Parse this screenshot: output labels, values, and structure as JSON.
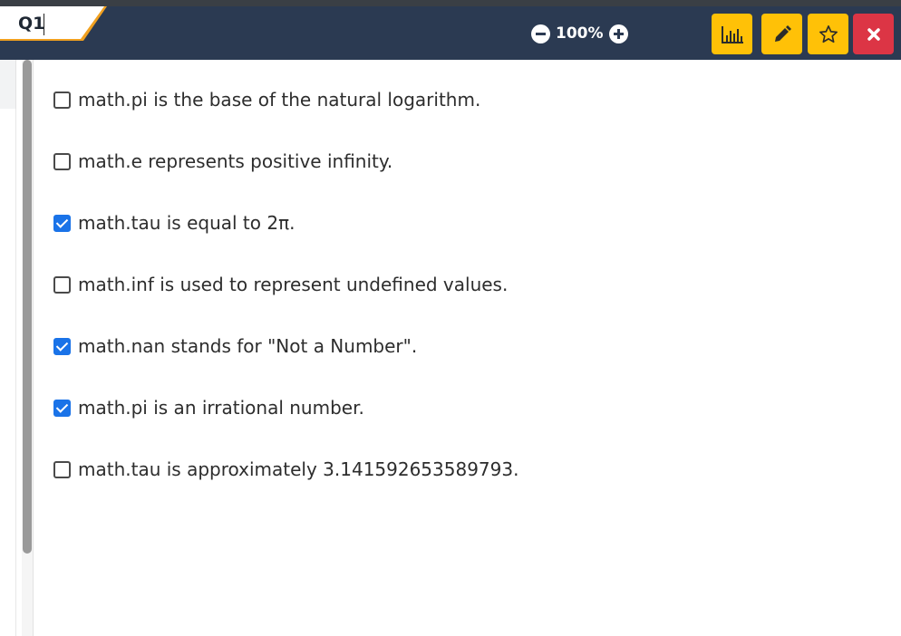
{
  "header": {
    "question_label": "Q1",
    "zoom_level": "100%",
    "accent_color": "#ffc107",
    "close_color": "#dc3545",
    "bar_color": "#2b3a52"
  },
  "toolbar": {
    "stats_icon": "bar-chart-icon",
    "edit_icon": "pencil-icon",
    "favorite_icon": "star-outline-icon",
    "close_icon": "close-icon"
  },
  "options": [
    {
      "text": "math.pi is the base of the natural logarithm.",
      "checked": false
    },
    {
      "text": "math.e represents positive infinity.",
      "checked": false
    },
    {
      "text": "math.tau is equal to 2π.",
      "checked": true
    },
    {
      "text": "math.inf is used to represent undefined values.",
      "checked": false
    },
    {
      "text": "math.nan stands for \"Not a Number\".",
      "checked": true
    },
    {
      "text": "math.pi is an irrational number.",
      "checked": true
    },
    {
      "text": "math.tau is approximately 3.141592653589793.",
      "checked": false
    }
  ]
}
